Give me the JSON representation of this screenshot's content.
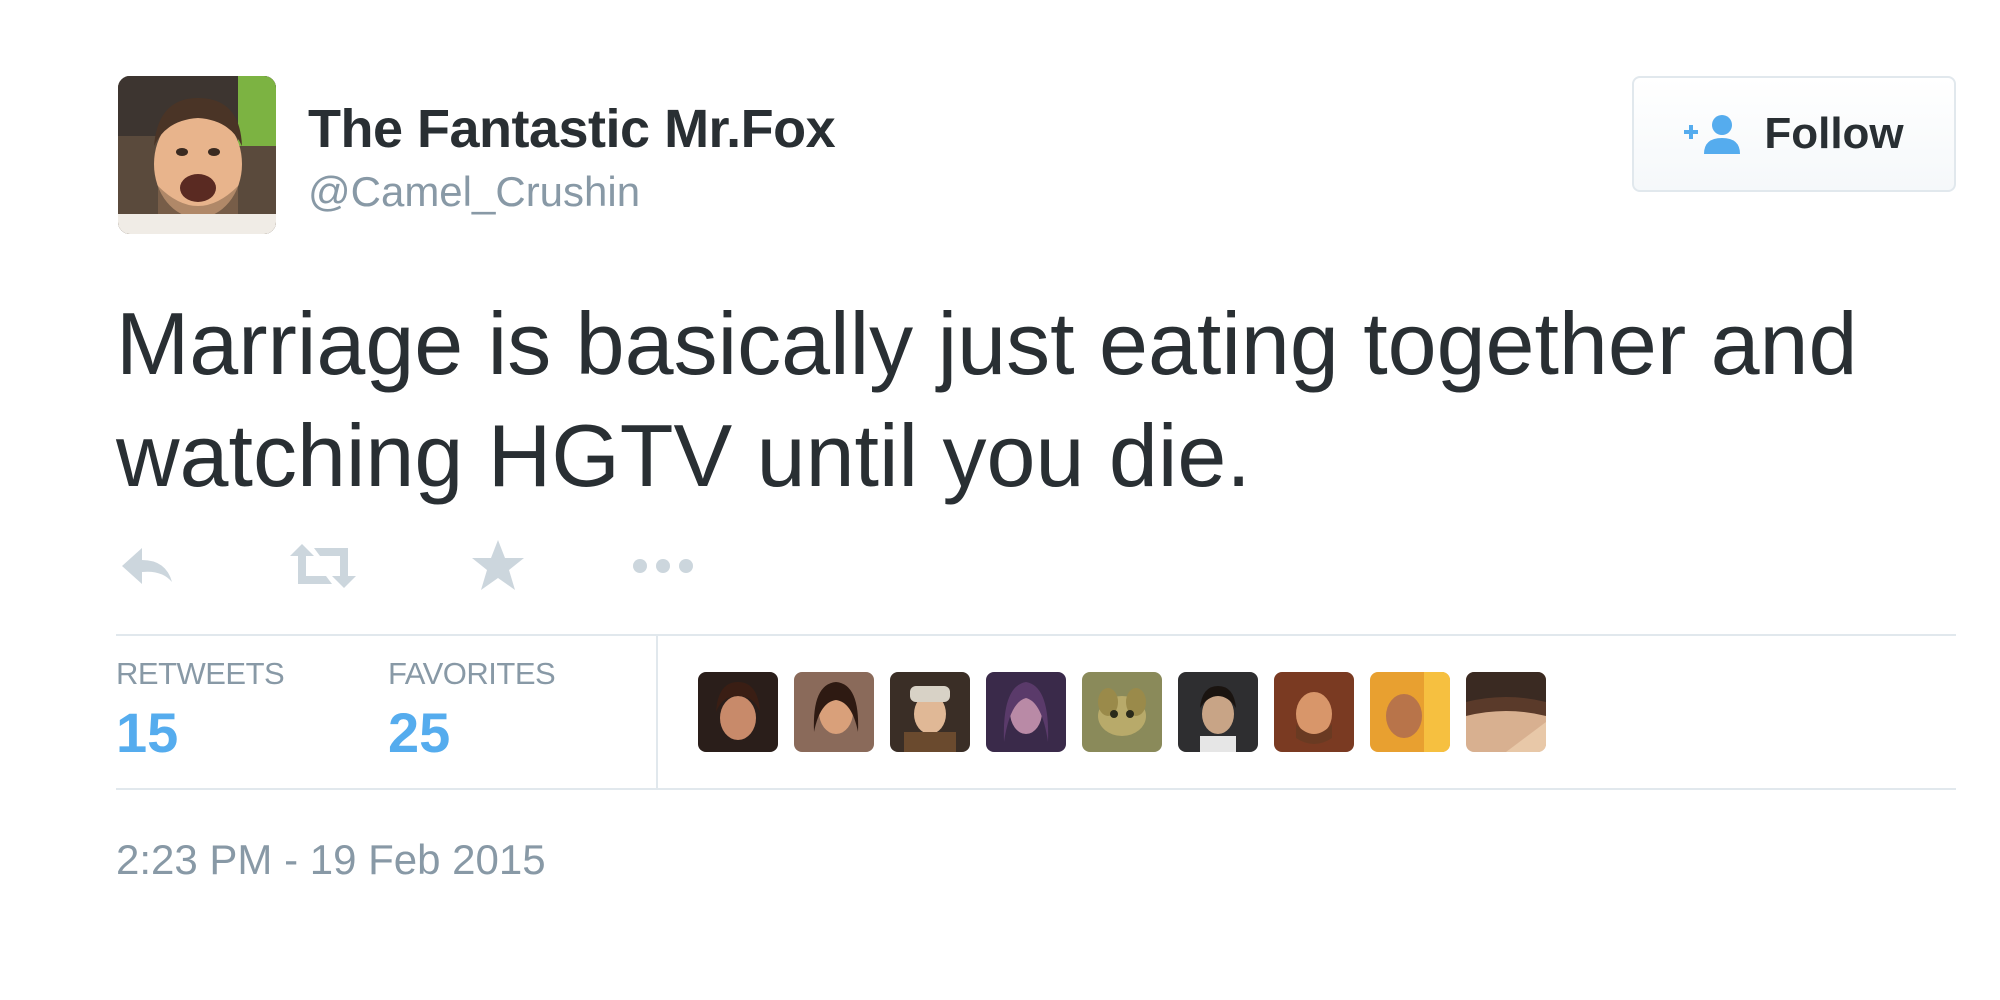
{
  "user": {
    "display_name": "The Fantastic Mr.Fox",
    "screen_name": "@Camel_Crushin",
    "avatar_icon": "profile-photo"
  },
  "follow_button": {
    "label": "Follow",
    "icon": "add-user-icon",
    "icon_color": "#55acee"
  },
  "tweet": {
    "text_line_1": "Marriage is basically just eating together and",
    "text_line_2": "watching HGTV until you die.",
    "timestamp": "2:23 PM - 19 Feb 2015"
  },
  "actions": [
    {
      "name": "reply",
      "icon": "reply-icon"
    },
    {
      "name": "retweet",
      "icon": "retweet-icon"
    },
    {
      "name": "favorite",
      "icon": "star-icon"
    },
    {
      "name": "more",
      "icon": "more-icon"
    }
  ],
  "stats": {
    "retweets_label": "RETWEETS",
    "retweets_value": "15",
    "favorites_label": "FAVORITES",
    "favorites_value": "25"
  },
  "favoriter_avatars_count": 9,
  "colors": {
    "text": "#292f33",
    "muted": "#8899a6",
    "accent": "#55acee",
    "icon_gray": "#ccd6dd",
    "border": "#e1e8ed"
  }
}
